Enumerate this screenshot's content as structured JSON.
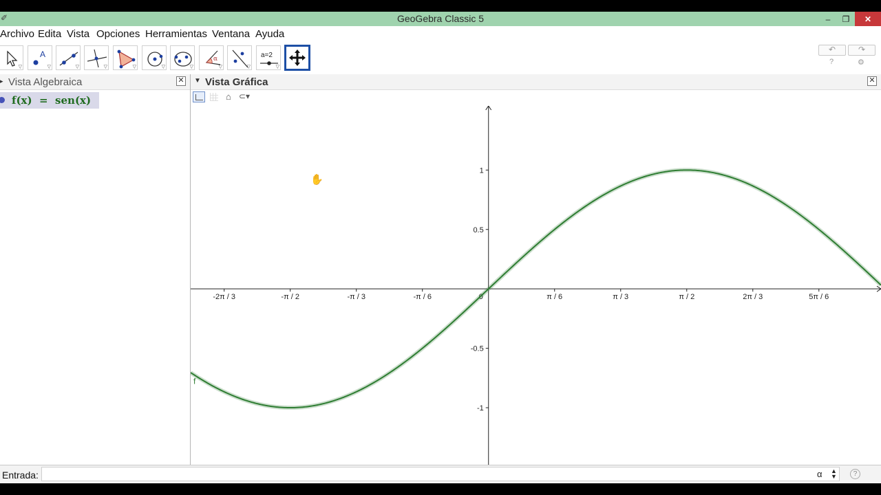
{
  "window": {
    "title": "GeoGebra Classic 5",
    "minimize_glyph": "‒",
    "maximize_glyph": "❐",
    "close_glyph": "✕"
  },
  "menu": [
    "Archivo",
    "Edita",
    "Vista",
    "Opciones",
    "Herramientas",
    "Ventana",
    "Ayuda"
  ],
  "toolbar": {
    "tools": [
      {
        "icon": "move-arrow-icon"
      },
      {
        "icon": "point-icon",
        "label": "A"
      },
      {
        "icon": "line-icon"
      },
      {
        "icon": "perpendicular-line-icon"
      },
      {
        "icon": "polygon-icon"
      },
      {
        "icon": "circle-center-point-icon"
      },
      {
        "icon": "ellipse-icon"
      },
      {
        "icon": "angle-icon",
        "label": "α"
      },
      {
        "icon": "reflect-line-icon"
      },
      {
        "icon": "slider-icon",
        "label": "a=2"
      },
      {
        "icon": "move-graphics-view-icon",
        "selected": true
      }
    ],
    "undo_glyph": "↶",
    "redo_glyph": "↷",
    "help_glyph": "?",
    "settings_glyph": "⚙"
  },
  "algebra_view": {
    "title": "Vista Algebraica",
    "objects": [
      {
        "formula": "f(x)  =  sen(x)",
        "color": "#1f6b1f"
      }
    ]
  },
  "graphics_view": {
    "title": "Vista Gráfica",
    "function_label": "f",
    "curve_color": "#2e7d32"
  },
  "chart_data": {
    "type": "line",
    "title": "",
    "xlabel": "",
    "ylabel": "",
    "series": [
      {
        "name": "f",
        "function": "sen(x)"
      }
    ],
    "x_ticks": [
      "-2π / 3",
      "-π / 2",
      "-π / 3",
      "-π / 6",
      "0",
      "π / 6",
      "π / 3",
      "π / 2",
      "2π / 3",
      "5π / 6"
    ],
    "x_tick_values": [
      -2.0944,
      -1.5708,
      -1.0472,
      -0.5236,
      0,
      0.5236,
      1.0472,
      1.5708,
      2.0944,
      2.618
    ],
    "y_ticks": [
      "1",
      "0.5",
      "-0.5",
      "-1"
    ],
    "y_tick_values": [
      1,
      0.5,
      -0.5,
      -1
    ],
    "xlim": [
      -2.36,
      3.11
    ],
    "ylim": [
      -1.48,
      1.54
    ],
    "grid": false
  },
  "input_bar": {
    "label": "Entrada:",
    "value": "",
    "alpha_glyph": "α",
    "help_glyph": "?"
  }
}
